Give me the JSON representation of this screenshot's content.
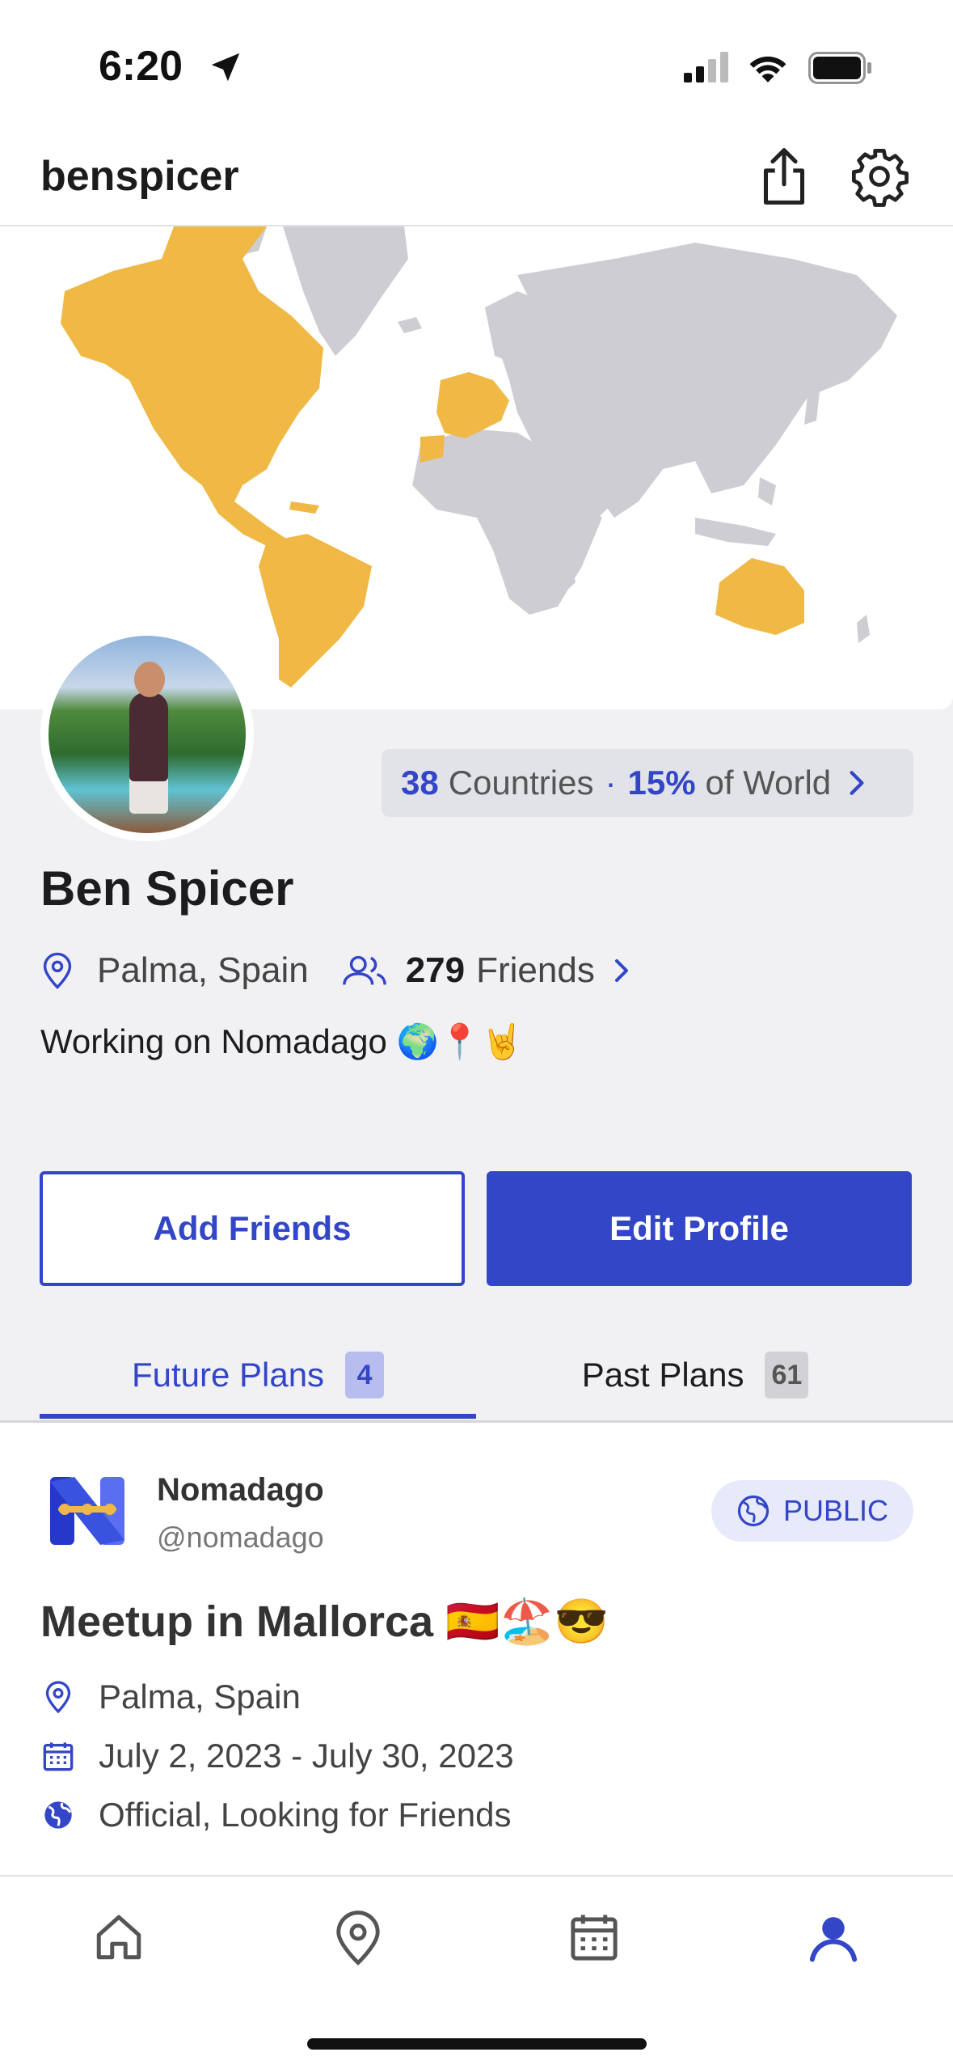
{
  "status_bar": {
    "time": "6:20"
  },
  "header": {
    "username": "benspicer"
  },
  "map": {
    "visited_color": "#F0B845",
    "unvisited_color": "#CDCDD3"
  },
  "stats": {
    "countries_count": "38",
    "countries_label": "Countries",
    "separator": "·",
    "world_percent": "15%",
    "world_label": "of World"
  },
  "profile": {
    "name": "Ben Spicer",
    "location": "Palma, Spain",
    "friends_count": "279",
    "friends_label": "Friends",
    "bio": "Working on Nomadago 🌍📍🤘"
  },
  "actions": {
    "add_friends": "Add Friends",
    "edit_profile": "Edit Profile"
  },
  "tabs": {
    "future": {
      "label": "Future Plans",
      "count": "4"
    },
    "past": {
      "label": "Past Plans",
      "count": "61"
    }
  },
  "plan": {
    "org_name": "Nomadago",
    "org_handle": "@nomadago",
    "visibility": "PUBLIC",
    "title": "Meetup in Mallorca 🇪🇸🏖️😎",
    "location": "Palma, Spain",
    "dates": "July 2, 2023 - July 30, 2023",
    "tags": "Official, Looking for Friends"
  },
  "nav": {
    "items": [
      "home-icon",
      "map-pin-icon",
      "calendar-icon",
      "profile-icon"
    ],
    "active": "profile-icon"
  },
  "colors": {
    "accent": "#3346C7",
    "background": "#F1F1F3"
  }
}
